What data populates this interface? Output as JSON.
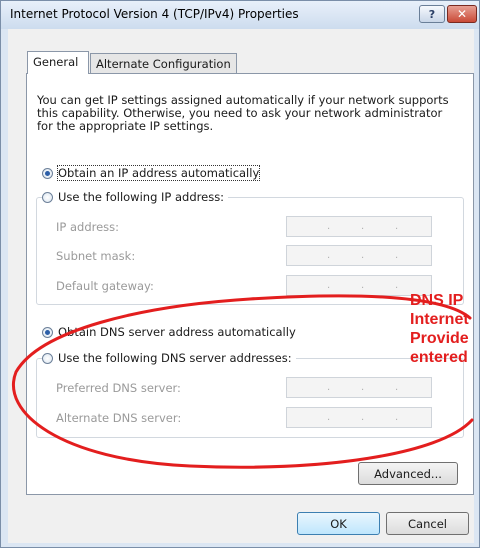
{
  "window": {
    "title": "Internet Protocol Version 4 (TCP/IPv4) Properties",
    "help_label": "?",
    "close_label": "✕"
  },
  "tabs": [
    {
      "label": "General",
      "selected": true
    },
    {
      "label": "Alternate Configuration",
      "selected": false
    }
  ],
  "intro_text": "You can get IP settings assigned automatically if your network supports this capability. Otherwise, you need to ask your network administrator for the appropriate IP settings.",
  "ip": {
    "auto_label": "Obtain an IP address automatically",
    "auto_selected": true,
    "manual_label": "Use the following IP address:",
    "fields": [
      {
        "label": "IP address:",
        "value": ""
      },
      {
        "label": "Subnet mask:",
        "value": ""
      },
      {
        "label": "Default gateway:",
        "value": ""
      }
    ]
  },
  "dns": {
    "auto_label": "Obtain DNS server address automatically",
    "auto_selected": true,
    "manual_label": "Use the following DNS server addresses:",
    "fields": [
      {
        "label": "Preferred DNS server:",
        "value": ""
      },
      {
        "label": "Alternate DNS server:",
        "value": ""
      }
    ]
  },
  "buttons": {
    "advanced": "Advanced...",
    "ok": "OK",
    "cancel": "Cancel"
  },
  "annotation": {
    "text": "DNS IP\nInternet\nProvide\nentered",
    "color": "#e31e1e"
  }
}
